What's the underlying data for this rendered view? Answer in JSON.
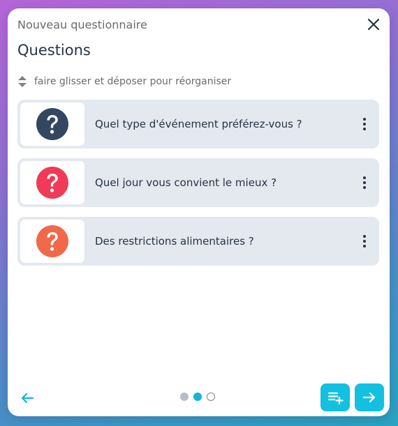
{
  "header": {
    "title": "Nouveau questionnaire"
  },
  "page": {
    "title": "Questions",
    "hint": "faire glisser et déposer pour réorganiser"
  },
  "questions": [
    {
      "label": "Quel type d'événement préférez-vous ?",
      "icon": "question-icon",
      "color": "#334760"
    },
    {
      "label": "Quel jour vous convient le mieux ?",
      "icon": "question-icon",
      "color": "#ef3b57"
    },
    {
      "label": "Des restrictions alimentaires ?",
      "icon": "question-icon",
      "color": "#f06a4a"
    }
  ],
  "pagination": {
    "current": 2,
    "total": 3
  },
  "colors": {
    "accent": "#14c0e0",
    "text": "#263445",
    "card": "#e4e8ef"
  }
}
